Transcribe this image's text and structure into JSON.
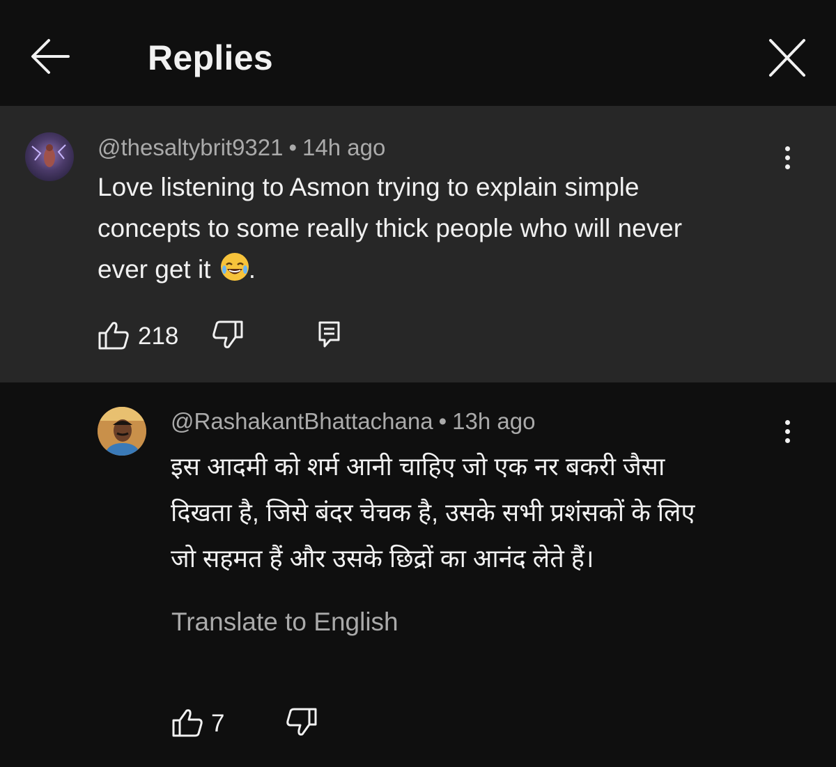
{
  "header": {
    "title": "Replies"
  },
  "parent_comment": {
    "author": "@thesaltybrit9321",
    "time": "14h ago",
    "text_lines": [
      "Love listening to Asmon trying to explain simple",
      "concepts to some really thick people who will never",
      "ever get it"
    ],
    "text_suffix": ".",
    "emoji": "face-with-tears-of-joy",
    "likes": "218"
  },
  "reply": {
    "author": "@RashakantBhattachana",
    "time": "13h ago",
    "text_lines": [
      "इस आदमी को शर्म आनी चाहिए जो एक नर बकरी जैसा",
      "दिखता है, जिसे बंदर चेचक है, उसके सभी प्रशंसकों के लिए",
      "जो सहमत हैं और उसके छिद्रों का आनंद लेते हैं।"
    ],
    "translate_label": "Translate to English",
    "likes": "7"
  },
  "separator": "•"
}
